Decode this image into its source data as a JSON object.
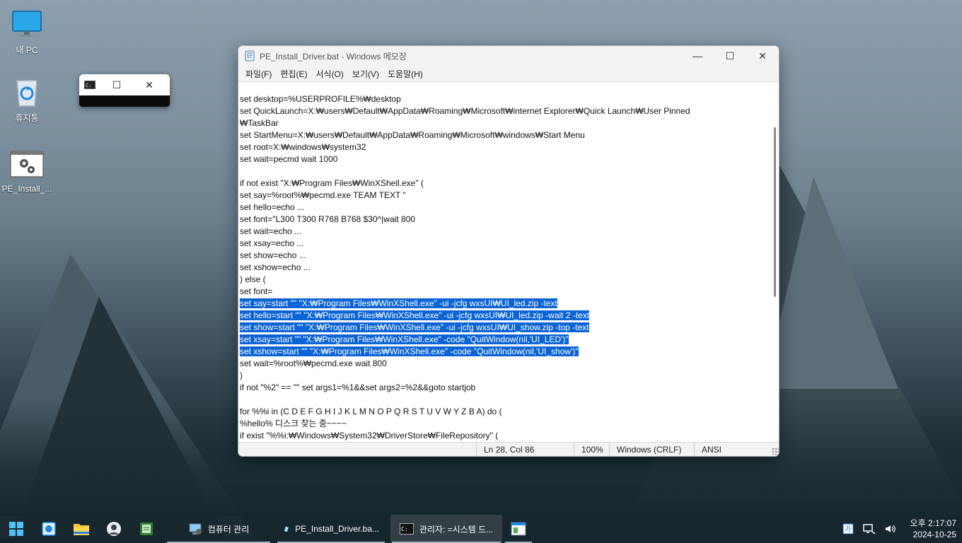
{
  "desktop": {
    "icons": [
      {
        "label": "내 PC",
        "icon": "monitor-icon"
      },
      {
        "label": "휴지통",
        "icon": "recycle-bin-icon"
      },
      {
        "label": "PE_Install_...",
        "icon": "batch-file-icon"
      }
    ]
  },
  "mini_window": {
    "icon": "console-icon",
    "maximize": "☐",
    "close": "✕"
  },
  "notepad": {
    "title": "PE_Install_Driver.bat - Windows 메모장",
    "controls": {
      "minimize": "—",
      "maximize": "☐",
      "close": "✕"
    },
    "menu": [
      "파일(F)",
      "편집(E)",
      "서식(O)",
      "보기(V)",
      "도움말(H)"
    ],
    "lines": [
      {
        "text": "set desktop=%USERPROFILE%₩desktop",
        "selected": false
      },
      {
        "text": "set QuickLaunch=X:₩users₩Default₩AppData₩Roaming₩Microsoft₩internet Explorer₩Quick Launch₩User Pinned",
        "selected": false
      },
      {
        "text": "₩TaskBar",
        "selected": false
      },
      {
        "text": "set StartMenu=X:₩users₩Default₩AppData₩Roaming₩Microsoft₩windows₩Start Menu",
        "selected": false
      },
      {
        "text": "set root=X:₩windows₩system32",
        "selected": false
      },
      {
        "text": "set wait=pecmd wait 1000",
        "selected": false
      },
      {
        "text": "",
        "selected": false
      },
      {
        "text": "if not exist \"X:₩Program Files₩WinXShell.exe\" (",
        "selected": false
      },
      {
        "text": "set say=%root%₩pecmd.exe TEAM TEXT \"",
        "selected": false
      },
      {
        "text": "set hello=echo ...",
        "selected": false
      },
      {
        "text": "set font=\"L300 T300 R768 B768 $30^|wait 800",
        "selected": false
      },
      {
        "text": "set wait=echo ...",
        "selected": false
      },
      {
        "text": "set xsay=echo ...",
        "selected": false
      },
      {
        "text": "set show=echo ...",
        "selected": false
      },
      {
        "text": "set xshow=echo ...",
        "selected": false
      },
      {
        "text": ") else (",
        "selected": false
      },
      {
        "text": "set font=",
        "selected": false
      },
      {
        "text": "set say=start \"\" \"X:₩Program Files₩WinXShell.exe\" -ui -jcfg wxsUI₩UI_led.zip -text",
        "selected": true
      },
      {
        "text": "set hello=start \"\" \"X:₩Program Files₩WinXShell.exe\" -ui -jcfg wxsUI₩UI_led.zip -wait 2 -text",
        "selected": true
      },
      {
        "text": "set show=start \"\" \"X:₩Program Files₩WinXShell.exe\" -ui -jcfg wxsUI₩UI_show.zip -top -text",
        "selected": true
      },
      {
        "text": "set xsay=start \"\" \"X:₩Program Files₩WinXShell.exe\" -code \"QuitWindow(nil,'UI_LED')\"",
        "selected": true
      },
      {
        "text": "set xshow=start \"\" \"X:₩Program Files₩WinXShell.exe\" -code \"QuitWindow(nil,'UI_show')\"",
        "selected": true
      },
      {
        "text": "set wait=%root%₩pecmd.exe wait 800",
        "selected": false
      },
      {
        "text": ")",
        "selected": false
      },
      {
        "text": "if not \"%2\" == \"\" set args1=%1&&set args2=%2&&goto startjob",
        "selected": false
      },
      {
        "text": "",
        "selected": false
      },
      {
        "text": "for %%i in (C D E F G H I J K L M N O P Q R S T U V W Y Z B A) do (",
        "selected": false
      },
      {
        "text": "%hello% 디스크 찾는 중~~~~",
        "selected": false
      },
      {
        "text": "if exist \"%%i:₩Windows₩System32₩DriverStore₩FileRepository\" (",
        "selected": false
      }
    ],
    "status": {
      "position": "Ln 28, Col 86",
      "zoom": "100%",
      "line_ending": "Windows (CRLF)",
      "encoding": "ANSI"
    }
  },
  "taskbar": {
    "pinned": [
      "start-icon",
      "control-panel-icon",
      "file-explorer-icon",
      "user-avatar-icon",
      "app-icon"
    ],
    "tasks": [
      {
        "label": "컴퓨터 관리",
        "icon": "computer-management-icon"
      },
      {
        "label": "PE_Install_Driver.ba...",
        "icon": "notepad-icon"
      },
      {
        "label": "관리자: =시스템 드...",
        "icon": "console-icon"
      }
    ],
    "tray": {
      "time": "오후 2:17:07",
      "date": "2024-10-25"
    }
  },
  "colors": {
    "selection": "#0a64d6",
    "taskbar": "#18262c",
    "accent": "#1a73e8"
  }
}
